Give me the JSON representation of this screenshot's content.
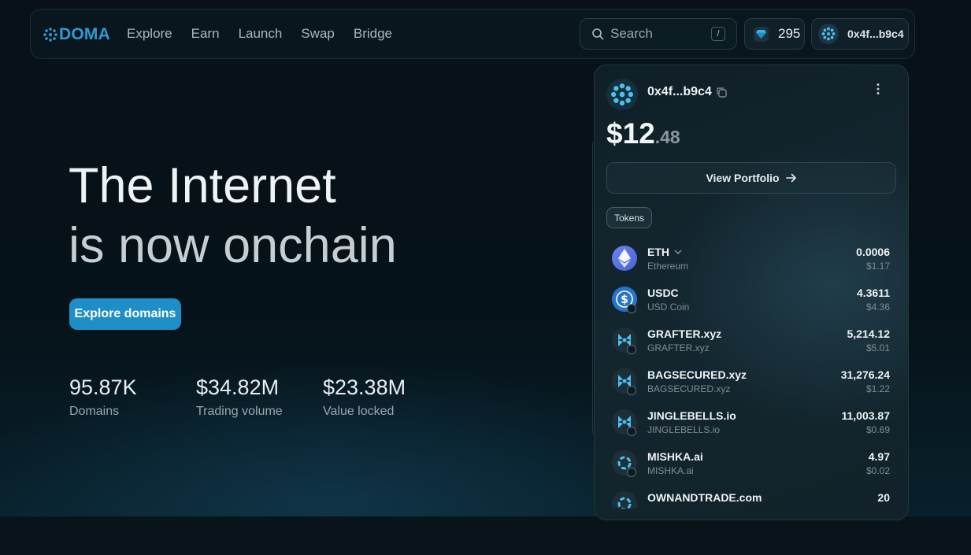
{
  "nav": {
    "brand": "DOMA",
    "links": [
      "Explore",
      "Earn",
      "Launch",
      "Swap",
      "Bridge"
    ],
    "search_placeholder": "Search",
    "search_shortcut": "/",
    "gems_count": "295",
    "account_address": "0x4f...b9c4"
  },
  "hero": {
    "title_line1": "The Internet",
    "title_line2": "is now onchain",
    "cta_label": "Explore domains",
    "stats": [
      {
        "value": "95.87K",
        "label": "Domains"
      },
      {
        "value": "$34.82M",
        "label": "Trading volume"
      },
      {
        "value": "$23.38M",
        "label": "Value locked"
      }
    ]
  },
  "wallet": {
    "address": "0x4f...b9c4",
    "balance_whole": "$12",
    "balance_cents": ".48",
    "view_portfolio_label": "View Portfolio",
    "tokens_tab_label": "Tokens",
    "tokens": [
      {
        "symbol": "ETH",
        "name": "Ethereum",
        "amount": "0.0006",
        "usd": "$1.17",
        "icon": "eth-icon"
      },
      {
        "symbol": "USDC",
        "name": "USD Coin",
        "amount": "4.3611",
        "usd": "$4.36",
        "icon": "usdc-icon"
      },
      {
        "symbol": "GRAFTER.xyz",
        "name": "GRAFTER.xyz",
        "amount": "5,214.12",
        "usd": "$5.01",
        "icon": "doma-token-icon"
      },
      {
        "symbol": "BAGSECURED.xyz",
        "name": "BAGSECURED.xyz",
        "amount": "31,276.24",
        "usd": "$1.22",
        "icon": "doma-token-icon"
      },
      {
        "symbol": "JINGLEBELLS.io",
        "name": "JINGLEBELLS.io",
        "amount": "11,003.87",
        "usd": "$0.69",
        "icon": "doma-token-icon"
      },
      {
        "symbol": "MISHKA.ai",
        "name": "MISHKA.ai",
        "amount": "4.97",
        "usd": "$0.02",
        "icon": "doma-token-icon"
      },
      {
        "symbol": "OWNANDTRADE.com",
        "name": "",
        "amount": "20",
        "usd": "",
        "icon": "doma-token-icon"
      }
    ]
  },
  "colors": {
    "accent": "#1e8fc6",
    "brand": "#2e9bd6",
    "background": "#061218"
  }
}
